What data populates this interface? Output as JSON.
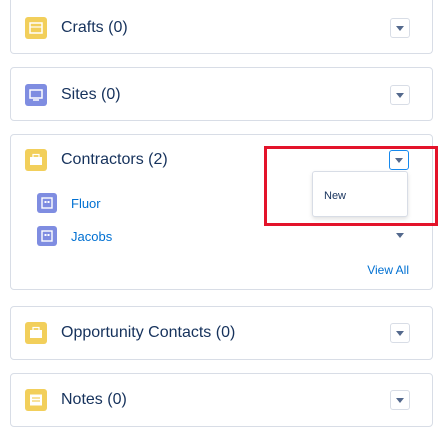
{
  "related_lists": [
    {
      "title": "Crafts (0)"
    },
    {
      "title": "Sites (0)"
    },
    {
      "title": "Contractors (2)",
      "records": [
        {
          "label": "Fluor",
          "icon": "account-icon"
        },
        {
          "label": "Jacobs",
          "icon": "account-icon"
        }
      ],
      "view_all": "View All",
      "menu": {
        "items": [
          "New"
        ]
      }
    },
    {
      "title": "Opportunity Contacts (0)"
    },
    {
      "title": "Notes (0)"
    }
  ],
  "colors": {
    "crafts_icon": "#f2cf5b",
    "sites_icon": "#7f8de1",
    "contractors_icon": "#f2cf5b",
    "opportunity_contacts_icon": "#f2cf5b",
    "notes_icon": "#f2cf5b",
    "record_icon": "#7f8de1",
    "highlight": "#e3132a",
    "link": "#0070d2",
    "text": "#16325c"
  }
}
